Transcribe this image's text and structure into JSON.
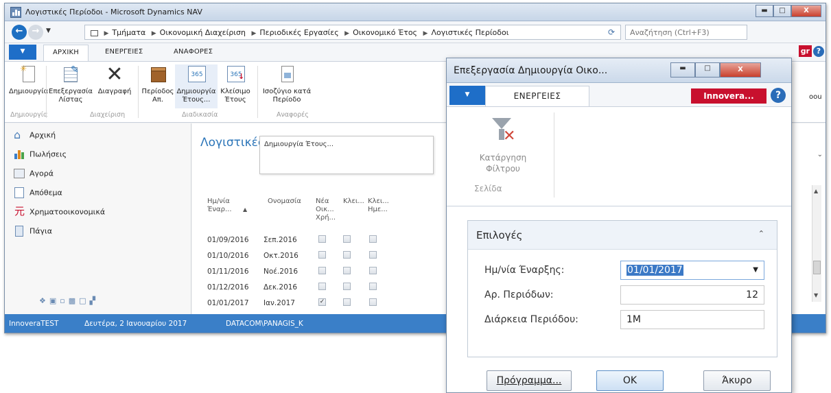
{
  "window": {
    "title": "Λογιστικές Περίοδοι - Microsoft Dynamics NAV",
    "minimize": "▬",
    "maximize": "□",
    "close": "X"
  },
  "address": {
    "breadcrumb": [
      "Τμήματα",
      "Οικονομική Διαχείριση",
      "Περιοδικές Εργασίες",
      "Οικονομικό Έτος",
      "Λογιστικές Περίοδοι"
    ],
    "search_placeholder": "Αναζήτηση (Ctrl+F3)"
  },
  "ribbon_tabs": {
    "home": "ΑΡΧΙΚΗ",
    "actions": "ΕΝΕΡΓΕΙΕΣ",
    "reports": "ΑΝΑΦΟΡΕΣ",
    "right_partial": "gr"
  },
  "ribbon": {
    "new": "Δημιουργία",
    "edit_list": [
      "Επεξεργασία",
      "Λίστας"
    ],
    "delete": "Διαγραφή",
    "period_acc": [
      "Περίοδος",
      "Απ."
    ],
    "create_year": [
      "Δημιουργία",
      "Έτους..."
    ],
    "close_year": [
      "Κλείσιμο",
      "Έτους"
    ],
    "trial_balance": [
      "Ισοζύγιο κατά",
      "Περίοδο"
    ],
    "right_partial": "oou",
    "icon_365": "365",
    "groups": {
      "new": "Δημιουργία",
      "manage": "Διαχείριση",
      "process": "Διαδικασία",
      "reports": "Αναφορές"
    }
  },
  "nav": {
    "items": [
      "Αρχική",
      "Πωλήσεις",
      "Αγορά",
      "Απόθεμα",
      "Χρηματοοικονομικά",
      "Πάγια"
    ]
  },
  "content": {
    "page_title": "Λογιστικές",
    "tooltip": "Δημιουργία Έτους...",
    "columns": {
      "start_date": [
        "Ημ/νία",
        "Έναρ..."
      ],
      "name": "Ονομασία",
      "new_year": [
        "Νέα",
        "Οικ...",
        "Χρή..."
      ],
      "closed": "Κλει...",
      "closed_date": [
        "Κλει...",
        "Ημε..."
      ]
    },
    "rows": [
      {
        "date": "01/09/2016",
        "name": "Σεπ.2016",
        "new_year": false
      },
      {
        "date": "01/10/2016",
        "name": "Οκτ.2016",
        "new_year": false
      },
      {
        "date": "01/11/2016",
        "name": "Νοέ.2016",
        "new_year": false
      },
      {
        "date": "01/12/2016",
        "name": "Δεκ.2016",
        "new_year": false
      },
      {
        "date": "01/01/2017",
        "name": "Ιαν.2017",
        "new_year": true
      }
    ]
  },
  "status": {
    "company": "InnoveraTEST",
    "date": "Δευτέρα, 2 Ιανουαρίου 2017",
    "user": "DATACOM\\PANAGIS_K"
  },
  "dialog": {
    "title": "Επεξεργασία  Δημιουργία Οικο...",
    "tab_actions": "ΕΝΕΡΓΕΙΕΣ",
    "brand": "Innovera...",
    "help": "?",
    "clear_filter": [
      "Κατάργηση",
      "Φίλτρου"
    ],
    "group_page": "Σελίδα",
    "options_title": "Επιλογές",
    "fields": {
      "start_date_label": "Ημ/νία Έναρξης:",
      "start_date_value": "01/01/2017",
      "periods_label": "Αρ. Περιόδων:",
      "periods_value": "12",
      "period_length_label": "Διάρκεια Περιόδου:",
      "period_length_value": "1M"
    },
    "buttons": {
      "program": "Πρόγραμμα...",
      "ok": "OK",
      "cancel": "Άκυρο"
    }
  }
}
